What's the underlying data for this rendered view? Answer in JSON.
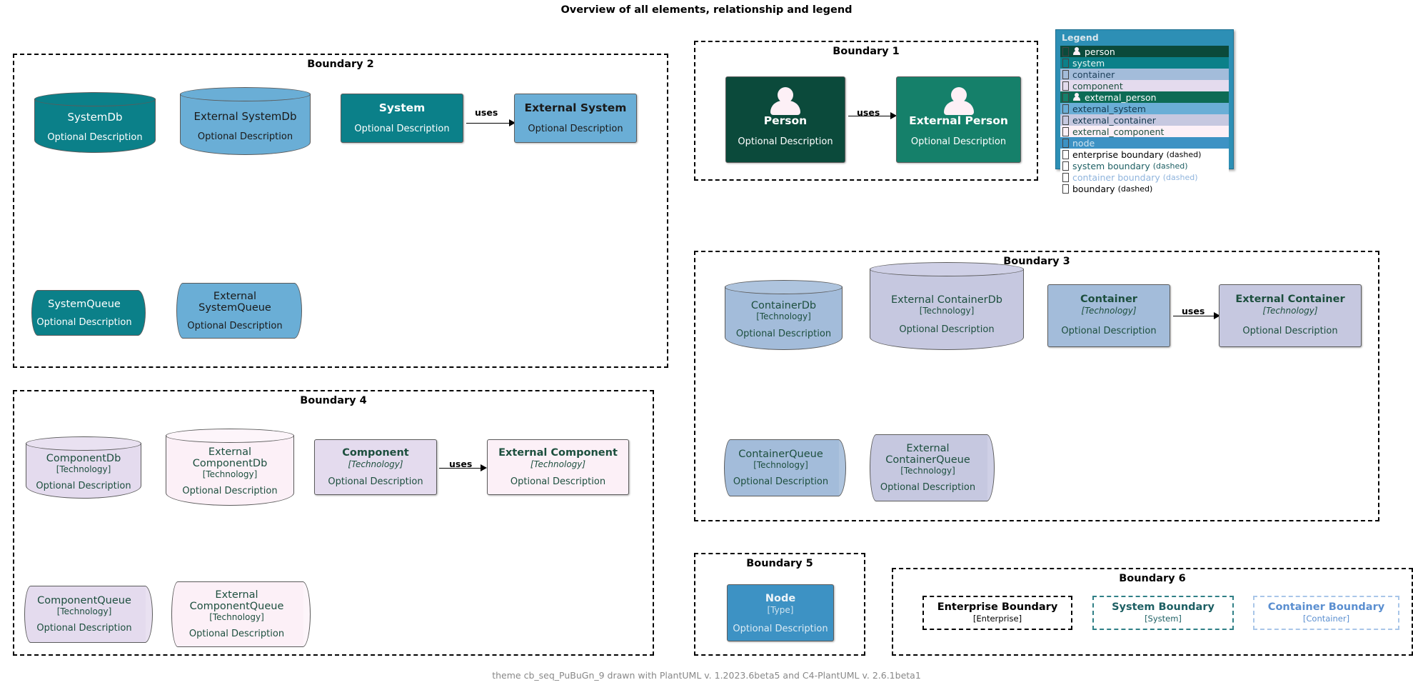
{
  "title": "Overview of all elements, relationship and legend",
  "footer": "theme cb_seq_PuBuGn_9 drawn with PlantUML v. 1.2023.6beta5 and C4-PlantUML v. 2.6.1beta1",
  "labels": {
    "optional_description": "Optional Description",
    "technology": "[Technology]",
    "type": "[Type]",
    "uses": "uses"
  },
  "boundaries": {
    "b1": "Boundary 1",
    "b2": "Boundary 2",
    "b3": "Boundary 3",
    "b4": "Boundary 4",
    "b5": "Boundary 5",
    "b6": "Boundary 6"
  },
  "elements": {
    "system_db": {
      "name": "SystemDb",
      "desc": "Optional Description"
    },
    "external_system_db": {
      "name": "External SystemDb",
      "desc": "Optional Description"
    },
    "system": {
      "name": "System",
      "desc": "Optional Description"
    },
    "external_system": {
      "name": "External System",
      "desc": "Optional Description"
    },
    "system_queue": {
      "name": "SystemQueue",
      "desc": "Optional Description"
    },
    "external_system_queue": {
      "name": "External\nSystemQueue",
      "line1": "External",
      "line2": "SystemQueue",
      "desc": "Optional Description"
    },
    "person": {
      "name": "Person",
      "desc": "Optional Description"
    },
    "external_person": {
      "name": "External Person",
      "desc": "Optional Description"
    },
    "container_db": {
      "name": "ContainerDb",
      "tech": "[Technology]",
      "desc": "Optional Description"
    },
    "external_container_db": {
      "name": "External ContainerDb",
      "tech": "[Technology]",
      "desc": "Optional Description"
    },
    "container": {
      "name": "Container",
      "tech": "[Technology]",
      "desc": "Optional Description"
    },
    "external_container": {
      "name": "External Container",
      "tech": "[Technology]",
      "desc": "Optional Description"
    },
    "container_queue": {
      "name": "ContainerQueue",
      "tech": "[Technology]",
      "desc": "Optional Description"
    },
    "external_container_queue": {
      "line1": "External",
      "line2": "ContainerQueue",
      "tech": "[Technology]",
      "desc": "Optional Description"
    },
    "component_db": {
      "name": "ComponentDb",
      "tech": "[Technology]",
      "desc": "Optional Description"
    },
    "external_component_db": {
      "line1": "External",
      "line2": "ComponentDb",
      "tech": "[Technology]",
      "desc": "Optional Description"
    },
    "component": {
      "name": "Component",
      "tech": "[Technology]",
      "desc": "Optional Description"
    },
    "external_component": {
      "name": "External Component",
      "tech": "[Technology]",
      "desc": "Optional Description"
    },
    "component_queue": {
      "name": "ComponentQueue",
      "tech": "[Technology]",
      "desc": "Optional Description"
    },
    "external_component_queue": {
      "line1": "External",
      "line2": "ComponentQueue",
      "tech": "[Technology]",
      "desc": "Optional Description"
    },
    "node": {
      "name": "Node",
      "tech": "[Type]",
      "desc": "Optional Description"
    },
    "enterprise_boundary_sample": {
      "name": "Enterprise Boundary",
      "tech": "[Enterprise]"
    },
    "system_boundary_sample": {
      "name": "System Boundary",
      "tech": "[System]"
    },
    "container_boundary_sample": {
      "name": "Container Boundary",
      "tech": "[Container]"
    }
  },
  "relationships": [
    {
      "label": "uses",
      "from": "system",
      "to": "external_system"
    },
    {
      "label": "uses",
      "from": "person",
      "to": "external_person"
    },
    {
      "label": "uses",
      "from": "container",
      "to": "external_container"
    },
    {
      "label": "uses",
      "from": "component",
      "to": "external_component"
    }
  ],
  "legend": {
    "title": "Legend",
    "rows": [
      {
        "label": "person",
        "sub": "",
        "swatch": "#0b4a3b",
        "text": "#ffffff",
        "row_bg": "#0b4a3b",
        "person": true
      },
      {
        "label": "system",
        "sub": "",
        "swatch": "#0b8089",
        "text": "#e8f4f2",
        "row_bg": "#0b8089",
        "person": false
      },
      {
        "label": "container",
        "sub": "",
        "swatch": "#a3bcda",
        "text": "#1c3f5a",
        "row_bg": "#a3bcda",
        "person": false
      },
      {
        "label": "component",
        "sub": "",
        "swatch": "#e4dbee",
        "text": "#1d4f3e",
        "row_bg": "#e4dbee",
        "person": false
      },
      {
        "label": "external_person",
        "sub": "",
        "swatch": "#15806a",
        "text": "#ffffff",
        "row_bg": "#0d6b55",
        "person": true
      },
      {
        "label": "external_system",
        "sub": "",
        "swatch": "#6aaed6",
        "text": "#13384e",
        "row_bg": "#6aaed6",
        "person": false
      },
      {
        "label": "external_container",
        "sub": "",
        "swatch": "#c6c8e0",
        "text": "#13384e",
        "row_bg": "#c6c8e0",
        "person": false
      },
      {
        "label": "external_component",
        "sub": "",
        "swatch": "#fcf0f7",
        "text": "#1d4f3e",
        "row_bg": "#fcf0f7",
        "person": false
      },
      {
        "label": "node",
        "sub": "",
        "swatch": "#3d92c4",
        "text": "#cfe3ef",
        "row_bg": "#3d92c4",
        "person": false
      },
      {
        "label": "enterprise boundary",
        "sub": "(dashed)",
        "swatch": "#ffffff",
        "text": "#000000",
        "row_bg": "#ffffff",
        "person": false
      },
      {
        "label": "system boundary",
        "sub": "(dashed)",
        "swatch": "#ffffff",
        "text": "#1d5f63",
        "row_bg": "#ffffff",
        "person": false
      },
      {
        "label": "container boundary",
        "sub": "(dashed)",
        "swatch": "#ffffff",
        "text": "#8fb4dd",
        "row_bg": "#ffffff",
        "person": false
      },
      {
        "label": "boundary",
        "sub": "(dashed)",
        "swatch": "#ffffff",
        "text": "#000000",
        "row_bg": "#ffffff",
        "person": false
      }
    ]
  },
  "colors": {
    "person": "#0b4a3b",
    "external_person": "#15806a",
    "system": "#0b8089",
    "external_system": "#6aaed6",
    "container": "#a3bcda",
    "external_container": "#c6c8e0",
    "component": "#e4dbee",
    "external_component": "#fcf0f7",
    "node": "#3d92c4",
    "legend_bg": "#2d8fb5",
    "enterprise_boundary_text": "#000000",
    "system_boundary_text": "#1d5f63",
    "container_boundary_text": "#5b8fd0"
  }
}
